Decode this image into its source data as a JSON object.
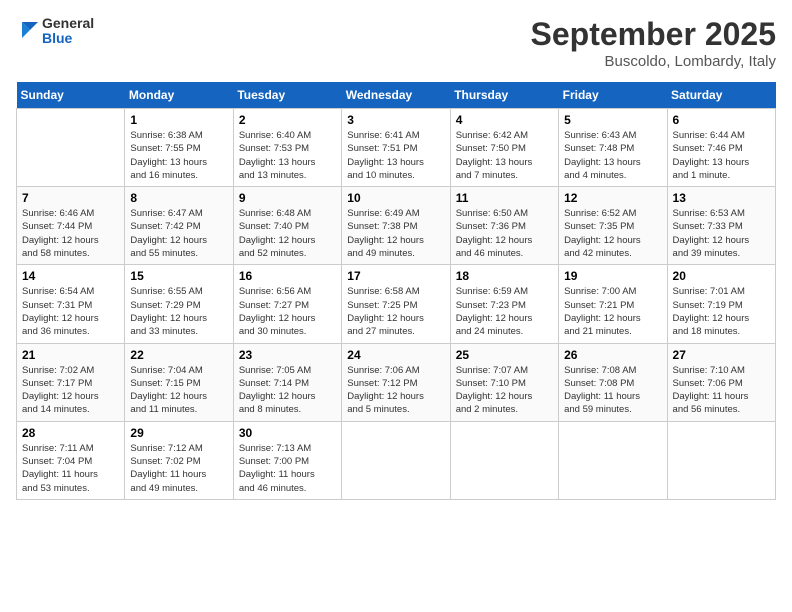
{
  "header": {
    "logo_line1": "General",
    "logo_line2": "Blue",
    "month": "September 2025",
    "location": "Buscoldo, Lombardy, Italy"
  },
  "weekdays": [
    "Sunday",
    "Monday",
    "Tuesday",
    "Wednesday",
    "Thursday",
    "Friday",
    "Saturday"
  ],
  "weeks": [
    [
      {
        "day": "",
        "info": ""
      },
      {
        "day": "1",
        "info": "Sunrise: 6:38 AM\nSunset: 7:55 PM\nDaylight: 13 hours\nand 16 minutes."
      },
      {
        "day": "2",
        "info": "Sunrise: 6:40 AM\nSunset: 7:53 PM\nDaylight: 13 hours\nand 13 minutes."
      },
      {
        "day": "3",
        "info": "Sunrise: 6:41 AM\nSunset: 7:51 PM\nDaylight: 13 hours\nand 10 minutes."
      },
      {
        "day": "4",
        "info": "Sunrise: 6:42 AM\nSunset: 7:50 PM\nDaylight: 13 hours\nand 7 minutes."
      },
      {
        "day": "5",
        "info": "Sunrise: 6:43 AM\nSunset: 7:48 PM\nDaylight: 13 hours\nand 4 minutes."
      },
      {
        "day": "6",
        "info": "Sunrise: 6:44 AM\nSunset: 7:46 PM\nDaylight: 13 hours\nand 1 minute."
      }
    ],
    [
      {
        "day": "7",
        "info": "Sunrise: 6:46 AM\nSunset: 7:44 PM\nDaylight: 12 hours\nand 58 minutes."
      },
      {
        "day": "8",
        "info": "Sunrise: 6:47 AM\nSunset: 7:42 PM\nDaylight: 12 hours\nand 55 minutes."
      },
      {
        "day": "9",
        "info": "Sunrise: 6:48 AM\nSunset: 7:40 PM\nDaylight: 12 hours\nand 52 minutes."
      },
      {
        "day": "10",
        "info": "Sunrise: 6:49 AM\nSunset: 7:38 PM\nDaylight: 12 hours\nand 49 minutes."
      },
      {
        "day": "11",
        "info": "Sunrise: 6:50 AM\nSunset: 7:36 PM\nDaylight: 12 hours\nand 46 minutes."
      },
      {
        "day": "12",
        "info": "Sunrise: 6:52 AM\nSunset: 7:35 PM\nDaylight: 12 hours\nand 42 minutes."
      },
      {
        "day": "13",
        "info": "Sunrise: 6:53 AM\nSunset: 7:33 PM\nDaylight: 12 hours\nand 39 minutes."
      }
    ],
    [
      {
        "day": "14",
        "info": "Sunrise: 6:54 AM\nSunset: 7:31 PM\nDaylight: 12 hours\nand 36 minutes."
      },
      {
        "day": "15",
        "info": "Sunrise: 6:55 AM\nSunset: 7:29 PM\nDaylight: 12 hours\nand 33 minutes."
      },
      {
        "day": "16",
        "info": "Sunrise: 6:56 AM\nSunset: 7:27 PM\nDaylight: 12 hours\nand 30 minutes."
      },
      {
        "day": "17",
        "info": "Sunrise: 6:58 AM\nSunset: 7:25 PM\nDaylight: 12 hours\nand 27 minutes."
      },
      {
        "day": "18",
        "info": "Sunrise: 6:59 AM\nSunset: 7:23 PM\nDaylight: 12 hours\nand 24 minutes."
      },
      {
        "day": "19",
        "info": "Sunrise: 7:00 AM\nSunset: 7:21 PM\nDaylight: 12 hours\nand 21 minutes."
      },
      {
        "day": "20",
        "info": "Sunrise: 7:01 AM\nSunset: 7:19 PM\nDaylight: 12 hours\nand 18 minutes."
      }
    ],
    [
      {
        "day": "21",
        "info": "Sunrise: 7:02 AM\nSunset: 7:17 PM\nDaylight: 12 hours\nand 14 minutes."
      },
      {
        "day": "22",
        "info": "Sunrise: 7:04 AM\nSunset: 7:15 PM\nDaylight: 12 hours\nand 11 minutes."
      },
      {
        "day": "23",
        "info": "Sunrise: 7:05 AM\nSunset: 7:14 PM\nDaylight: 12 hours\nand 8 minutes."
      },
      {
        "day": "24",
        "info": "Sunrise: 7:06 AM\nSunset: 7:12 PM\nDaylight: 12 hours\nand 5 minutes."
      },
      {
        "day": "25",
        "info": "Sunrise: 7:07 AM\nSunset: 7:10 PM\nDaylight: 12 hours\nand 2 minutes."
      },
      {
        "day": "26",
        "info": "Sunrise: 7:08 AM\nSunset: 7:08 PM\nDaylight: 11 hours\nand 59 minutes."
      },
      {
        "day": "27",
        "info": "Sunrise: 7:10 AM\nSunset: 7:06 PM\nDaylight: 11 hours\nand 56 minutes."
      }
    ],
    [
      {
        "day": "28",
        "info": "Sunrise: 7:11 AM\nSunset: 7:04 PM\nDaylight: 11 hours\nand 53 minutes."
      },
      {
        "day": "29",
        "info": "Sunrise: 7:12 AM\nSunset: 7:02 PM\nDaylight: 11 hours\nand 49 minutes."
      },
      {
        "day": "30",
        "info": "Sunrise: 7:13 AM\nSunset: 7:00 PM\nDaylight: 11 hours\nand 46 minutes."
      },
      {
        "day": "",
        "info": ""
      },
      {
        "day": "",
        "info": ""
      },
      {
        "day": "",
        "info": ""
      },
      {
        "day": "",
        "info": ""
      }
    ]
  ]
}
